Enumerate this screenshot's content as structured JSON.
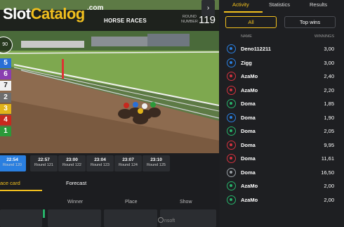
{
  "logo": {
    "slot": "Slot",
    "catalog": "Catalog",
    "com": ".com"
  },
  "race": {
    "title": "HORSE RACES",
    "round_label": "ROUND NUMBER",
    "round_number": "119",
    "timer": "90"
  },
  "horse_numbers": [
    {
      "label": "5",
      "color": "#2a6fd6"
    },
    {
      "label": "6",
      "color": "#8a3fb0"
    },
    {
      "label": "7",
      "color": "#f0f0f0"
    },
    {
      "label": "2",
      "color": "#6d6d6d"
    },
    {
      "label": "3",
      "color": "#e0b31a"
    },
    {
      "label": "4",
      "color": "#c8281e"
    },
    {
      "label": "1",
      "color": "#2b9a3a"
    }
  ],
  "rounds": [
    {
      "time": "22:54",
      "round": "Round 120",
      "active": true
    },
    {
      "time": "22:57",
      "round": "Round 121",
      "active": false
    },
    {
      "time": "23:00",
      "round": "Round 122",
      "active": false
    },
    {
      "time": "23:04",
      "round": "Round 123",
      "active": false
    },
    {
      "time": "23:07",
      "round": "Round 124",
      "active": false
    },
    {
      "time": "23:10",
      "round": "Round 125",
      "active": false
    }
  ],
  "next_icon": "chevron-right-icon",
  "bet_tabs": {
    "race_card": "ace card",
    "forecast": "Forecast"
  },
  "bet_columns": {
    "winner": "Winner",
    "place": "Place",
    "show": "Show"
  },
  "footer_brand": "nsoft",
  "panel": {
    "tabs": {
      "activity": "Activity",
      "statistics": "Statistics",
      "results": "Results"
    },
    "filters": {
      "all": "All",
      "top": "Top wins"
    },
    "list_header": {
      "name": "NAME",
      "winnings": "WINNINGS"
    },
    "rows": [
      {
        "name": "Deno112211",
        "value": "3,00",
        "color": "#2a7fe0"
      },
      {
        "name": "Zigg",
        "value": "3,00",
        "color": "#2a7fe0"
      },
      {
        "name": "AzaMo",
        "value": "2,40",
        "color": "#d4323e"
      },
      {
        "name": "AzaMo",
        "value": "2,20",
        "color": "#d4323e"
      },
      {
        "name": "Doma",
        "value": "1,85",
        "color": "#27b36a"
      },
      {
        "name": "Doma",
        "value": "1,90",
        "color": "#2a7fe0"
      },
      {
        "name": "Doma",
        "value": "2,05",
        "color": "#27b36a"
      },
      {
        "name": "Doma",
        "value": "9,95",
        "color": "#d4323e"
      },
      {
        "name": "Doma",
        "value": "11,61",
        "color": "#d4323e"
      },
      {
        "name": "Doma",
        "value": "16,50",
        "color": "#9aa0a6"
      },
      {
        "name": "AzaMo",
        "value": "2,00",
        "color": "#27b36a"
      },
      {
        "name": "AzaMo",
        "value": "2,00",
        "color": "#27b36a"
      }
    ]
  }
}
